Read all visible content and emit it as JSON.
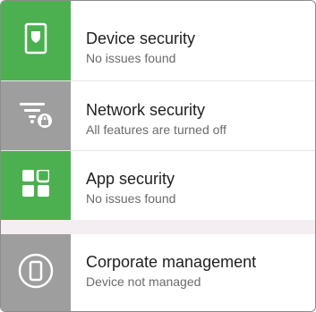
{
  "colors": {
    "ok": "#4cb050",
    "warn": "#9e9e9e",
    "section_gap": "#f4eef2"
  },
  "items": [
    {
      "title": "Device security",
      "subtitle": "No issues found",
      "status": "ok",
      "icon": "phone-shield-icon"
    },
    {
      "title": "Network security",
      "subtitle": "All features are turned off",
      "status": "off",
      "icon": "wifi-lock-icon"
    },
    {
      "title": "App security",
      "subtitle": "No issues found",
      "status": "ok",
      "icon": "apps-grid-icon"
    },
    {
      "title": "Corporate management",
      "subtitle": "Device not managed",
      "status": "off",
      "icon": "phone-circle-icon"
    }
  ]
}
